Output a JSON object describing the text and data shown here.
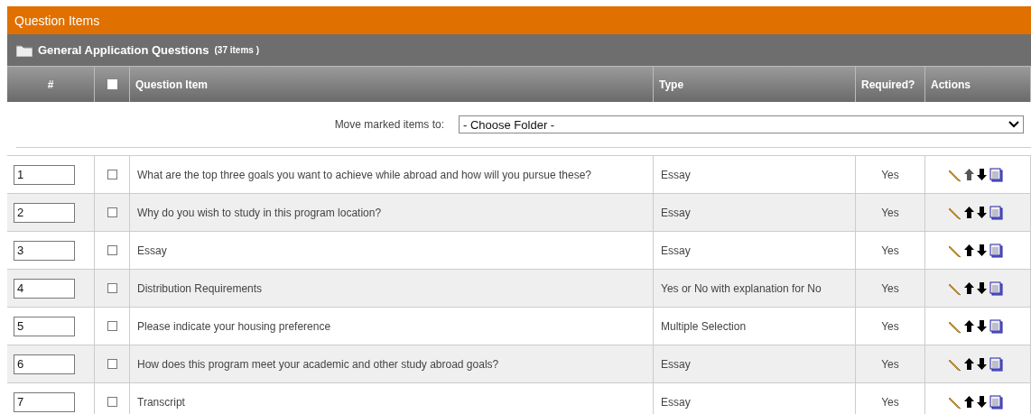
{
  "title": "Question Items",
  "folder": {
    "name": "General Application Questions",
    "count": "(37 items )"
  },
  "columns": {
    "number": "#",
    "select_all": {
      "checked": false
    },
    "question": "Question Item",
    "type": "Type",
    "required": "Required?",
    "actions": "Actions"
  },
  "move": {
    "label": "Move marked items to:",
    "value": "- Choose Folder -"
  },
  "rows": [
    {
      "number": "1",
      "checked": false,
      "question": "What are the top three goals you want to achieve while abroad and how will you pursue these?",
      "type": "Essay",
      "required": "Yes",
      "up_disabled": true
    },
    {
      "number": "2",
      "checked": false,
      "question": "Why do you wish to study in this program location?",
      "type": "Essay",
      "required": "Yes",
      "up_disabled": false
    },
    {
      "number": "3",
      "checked": false,
      "question": "Essay",
      "type": "Essay",
      "required": "Yes",
      "up_disabled": false
    },
    {
      "number": "4",
      "checked": false,
      "question": "Distribution Requirements",
      "type": "Yes or No with explanation for No",
      "required": "Yes",
      "up_disabled": false
    },
    {
      "number": "5",
      "checked": false,
      "question": "Please indicate your housing preference",
      "type": "Multiple Selection",
      "required": "Yes",
      "up_disabled": false
    },
    {
      "number": "6",
      "checked": false,
      "question": "How does this program meet your academic and other study abroad goals?",
      "type": "Essay",
      "required": "Yes",
      "up_disabled": false
    },
    {
      "number": "7",
      "checked": false,
      "question": "Transcript",
      "type": "Essay",
      "required": "Yes",
      "up_disabled": false
    }
  ]
}
